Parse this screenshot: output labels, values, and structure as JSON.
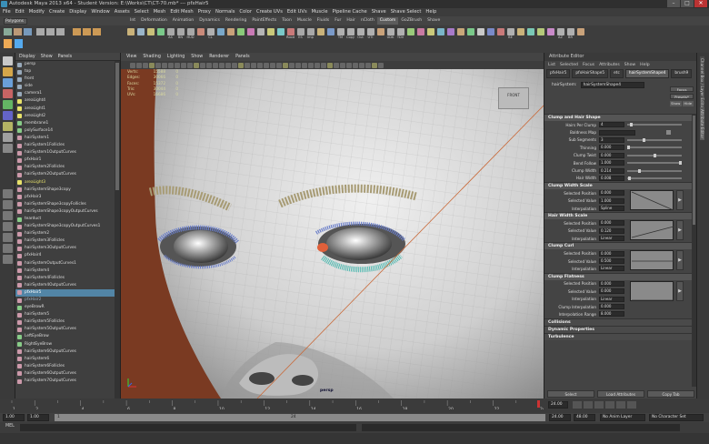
{
  "window": {
    "title": "Autodesk Maya 2013 x64 - Student Version: E:\\Works\\CT\\CT-70.mb* --- pfxHair5",
    "minimize_glyph": "–",
    "maximize_glyph": "□",
    "close_glyph": "✕"
  },
  "menubar": [
    "File",
    "Edit",
    "Modify",
    "Create",
    "Display",
    "Window",
    "Assets",
    "Select",
    "Mesh",
    "Edit Mesh",
    "Proxy",
    "Normals",
    "Color",
    "Create UVs",
    "Edit UVs",
    "Muscle",
    "Pipeline Cache",
    "Shave",
    "Shave Select",
    "Help"
  ],
  "mode_selector": "Polygons",
  "shelf_tabs": [
    {
      "label": "Int",
      "active": false
    },
    {
      "label": "Deformation",
      "active": false
    },
    {
      "label": "Animation",
      "active": false
    },
    {
      "label": "Dynamics",
      "active": false
    },
    {
      "label": "Rendering",
      "active": false
    },
    {
      "label": "PaintEffects",
      "active": false
    },
    {
      "label": "Toon",
      "active": false
    },
    {
      "label": "Muscle",
      "active": false
    },
    {
      "label": "Fluids",
      "active": false
    },
    {
      "label": "Fur",
      "active": false
    },
    {
      "label": "Hair",
      "active": false
    },
    {
      "label": "nCloth",
      "active": false
    },
    {
      "label": "Custom",
      "active": true
    },
    {
      "label": "GoZBrush",
      "active": false
    },
    {
      "label": "Shave",
      "active": false
    }
  ],
  "shelf_icons": [
    {
      "label": "",
      "color": "#c9b27a"
    },
    {
      "label": "",
      "color": "#9ab5c9"
    },
    {
      "label": "",
      "color": "#c9c07a"
    },
    {
      "label": "",
      "color": "#7ac98a"
    },
    {
      "label": "AS",
      "color": "#a8a8a8"
    },
    {
      "label": "BN",
      "color": "#a8a8a8"
    },
    {
      "label": "HUD",
      "color": "#a8a8a8"
    },
    {
      "label": "",
      "color": "#c98a7a"
    },
    {
      "label": "CL",
      "color": "#b0b0b0"
    },
    {
      "label": "",
      "color": "#7aa8c9"
    },
    {
      "label": "",
      "color": "#c9a27a"
    },
    {
      "label": "",
      "color": "#8ac97a"
    },
    {
      "label": "",
      "color": "#c97ab5"
    },
    {
      "label": "",
      "color": "#b5b5b5"
    },
    {
      "label": "",
      "color": "#c9c97a"
    },
    {
      "label": "",
      "color": "#7ac9c9"
    },
    {
      "label": "Rood",
      "color": "#c97a7a"
    },
    {
      "label": "ES",
      "color": "#a8a8a8"
    },
    {
      "label": "Imp",
      "color": "#a8a8a8"
    },
    {
      "label": "",
      "color": "#c9b27a"
    },
    {
      "label": "",
      "color": "#7a9ac9"
    },
    {
      "label": "TM",
      "color": "#b0b0b0"
    },
    {
      "label": "Copy",
      "color": "#b0b0b0"
    },
    {
      "label": "Out",
      "color": "#b0b0b0"
    },
    {
      "label": "UTI",
      "color": "#b0b0b0"
    },
    {
      "label": "",
      "color": "#c9a27a"
    },
    {
      "label": "UDK",
      "color": "#b0b0b0"
    },
    {
      "label": "TDV",
      "color": "#b0b0b0"
    },
    {
      "label": "",
      "color": "#9ac97a"
    },
    {
      "label": "",
      "color": "#c97aa2"
    },
    {
      "label": "",
      "color": "#c9c97a"
    },
    {
      "label": "",
      "color": "#7ab5c9"
    },
    {
      "label": "",
      "color": "#a87ac9"
    },
    {
      "label": "",
      "color": "#c9a87a"
    },
    {
      "label": "",
      "color": "#7ac98a"
    },
    {
      "label": "",
      "color": "#c9c9c9"
    },
    {
      "label": "",
      "color": "#7a8ac9"
    },
    {
      "label": "",
      "color": "#c97a7a"
    },
    {
      "label": "BE",
      "color": "#b0b0b0"
    },
    {
      "label": "",
      "color": "#c9b27a"
    },
    {
      "label": "",
      "color": "#7ac9b5"
    },
    {
      "label": "",
      "color": "#b5c97a"
    },
    {
      "label": "",
      "color": "#c98ac9"
    },
    {
      "label": "AZ",
      "color": "#b0b0b0"
    },
    {
      "label": "BR",
      "color": "#b0b0b0"
    },
    {
      "label": "",
      "color": "#c9a27a"
    }
  ],
  "outliner": {
    "menu": [
      "Display",
      "Show",
      "Panels"
    ],
    "items": [
      {
        "label": "persp",
        "glyph": "#9ab",
        "style": "normal"
      },
      {
        "label": "top",
        "glyph": "#9ab",
        "style": "normal"
      },
      {
        "label": "front",
        "glyph": "#9ab",
        "style": "normal"
      },
      {
        "label": "side",
        "glyph": "#9ab",
        "style": "normal"
      },
      {
        "label": "camera1",
        "glyph": "#9ab",
        "style": "normal"
      },
      {
        "label": "areaLight4",
        "glyph": "#e8e26a",
        "style": "normal"
      },
      {
        "label": "areaLight1",
        "glyph": "#e8e26a",
        "style": "normal"
      },
      {
        "label": "areaLight2",
        "glyph": "#e8e26a",
        "style": "normal"
      },
      {
        "label": "membrane1",
        "glyph": "#8c8",
        "style": "normal"
      },
      {
        "label": "polySurface14",
        "glyph": "#8c8",
        "style": "normal"
      },
      {
        "label": "hairSystem1",
        "glyph": "#c9a",
        "style": "normal"
      },
      {
        "label": "hairSystem1Follicles",
        "glyph": "#c9a",
        "style": "normal"
      },
      {
        "label": "hairSystem1OutputCurves",
        "glyph": "#c9a",
        "style": "normal"
      },
      {
        "label": "pfxHair1",
        "glyph": "#c9a",
        "style": "normal"
      },
      {
        "label": "hairSystem2Follicles",
        "glyph": "#c9a",
        "style": "normal"
      },
      {
        "label": "hairSystem2OutputCurves",
        "glyph": "#c9a",
        "style": "normal"
      },
      {
        "label": "areaLight3",
        "glyph": "#e8e26a",
        "style": "yel"
      },
      {
        "label": "hairSystemShape3copy",
        "glyph": "#c9a",
        "style": "normal"
      },
      {
        "label": "pfxHair3",
        "glyph": "#c9a",
        "style": "normal"
      },
      {
        "label": "hairSystemShape3copyFollicles",
        "glyph": "#c9a",
        "style": "normal"
      },
      {
        "label": "hairSystemShape3copyOutputCurves",
        "glyph": "#c9a",
        "style": "normal"
      },
      {
        "label": "tearduct",
        "glyph": "#8c8",
        "style": "normal"
      },
      {
        "label": "hairSystemShape3copyOutputCurves1",
        "glyph": "#c9a",
        "style": "normal"
      },
      {
        "label": "hairSystem2",
        "glyph": "#c9a",
        "style": "normal"
      },
      {
        "label": "hairSystem3Follicles",
        "glyph": "#c9a",
        "style": "normal"
      },
      {
        "label": "hairSystem3OutputCurves",
        "glyph": "#c9a",
        "style": "normal"
      },
      {
        "label": "pfxHair4",
        "glyph": "#c9a",
        "style": "normal"
      },
      {
        "label": "hairSystemOutputCurves1",
        "glyph": "#c9a",
        "style": "normal"
      },
      {
        "label": "hairSystem4",
        "glyph": "#c9a",
        "style": "normal"
      },
      {
        "label": "hairSystem4Follicles",
        "glyph": "#c9a",
        "style": "normal"
      },
      {
        "label": "hairSystem4OutputCurves",
        "glyph": "#c9a",
        "style": "normal"
      },
      {
        "label": "pfxHair5",
        "glyph": "#c9a",
        "style": "sel"
      },
      {
        "label": "pfxHair2",
        "glyph": "#c9a",
        "style": "dim"
      },
      {
        "label": "eyeBrowR",
        "glyph": "#8c8",
        "style": "normal"
      },
      {
        "label": "hairSystem5",
        "glyph": "#c9a",
        "style": "normal"
      },
      {
        "label": "hairSystem5Follicles",
        "glyph": "#c9a",
        "style": "normal"
      },
      {
        "label": "hairSystem5OutputCurves",
        "glyph": "#c9a",
        "style": "normal"
      },
      {
        "label": "LeftEyeBrow",
        "glyph": "#8c8",
        "style": "normal"
      },
      {
        "label": "RightEyeBrow",
        "glyph": "#8c8",
        "style": "normal"
      },
      {
        "label": "hairSystem6OutputCurves",
        "glyph": "#c9a",
        "style": "normal"
      },
      {
        "label": "hairSystem6",
        "glyph": "#c9a",
        "style": "normal"
      },
      {
        "label": "hairSystem6Follicles",
        "glyph": "#c9a",
        "style": "normal"
      },
      {
        "label": "hairSystem6OutputCurves",
        "glyph": "#c9a",
        "style": "normal"
      },
      {
        "label": "hairSystem7OutputCurves",
        "glyph": "#c9a",
        "style": "normal"
      }
    ]
  },
  "viewport": {
    "menu": [
      "View",
      "Shading",
      "Lighting",
      "Show",
      "Renderer",
      "Panels"
    ],
    "hud": [
      {
        "label": "Verts:",
        "v1": "15588",
        "v2": "0"
      },
      {
        "label": "Edges:",
        "v1": "30066",
        "v2": "0"
      },
      {
        "label": "Faces:",
        "v1": "15372",
        "v2": "0"
      },
      {
        "label": "Tris:",
        "v1": "30044",
        "v2": "0"
      },
      {
        "label": "UVs:",
        "v1": "16686",
        "v2": "0"
      }
    ],
    "viewcube_label": "FRONT",
    "camera_label": "persp",
    "colors": {
      "background": "#7a3a22",
      "skin": "#d9d9d9",
      "lash_blue": "#6a7ec9",
      "lash_teal": "#4fb9b0",
      "brow": "#a79b74"
    }
  },
  "attribute_editor": {
    "title": "Attribute Editor",
    "menu": [
      "List",
      "Selected",
      "Focus",
      "Attributes",
      "Show",
      "Help"
    ],
    "tabs": [
      {
        "label": "pfxHair5",
        "active": false
      },
      {
        "label": "pfxHairShape5",
        "active": false
      },
      {
        "label": "etc",
        "active": false
      },
      {
        "label": "hairSystemShape4",
        "active": true
      },
      {
        "label": "brush9",
        "active": false
      }
    ],
    "node_label": "hairSystem:",
    "node_value": "hairSystemShape4",
    "focus_button": "Focus",
    "presets_button": "Presets*",
    "show_label": "Show",
    "hide_label": "Hide",
    "sections": {
      "clump_hair_shape": {
        "title": "Clump and Hair Shape",
        "rows": [
          {
            "label": "Hairs Per Clump",
            "value": "4",
            "slider": 0.05
          },
          {
            "label": "Baldness Map",
            "value": "",
            "slider": null
          },
          {
            "label": "Sub Segments",
            "value": "3",
            "slider": 0.3
          },
          {
            "label": "Thinning",
            "value": "0.000",
            "slider": 0.0
          },
          {
            "label": "Clump Twist",
            "value": "0.000",
            "slider": 0.5
          },
          {
            "label": "Bend Follow",
            "value": "1.000",
            "slider": 1.0
          },
          {
            "label": "Clump Width",
            "value": "0.214",
            "slider": 0.21
          },
          {
            "label": "Hair Width",
            "value": "0.008",
            "slider": 0.01
          }
        ]
      },
      "clump_width_scale": {
        "title": "Clump Width Scale",
        "rows": [
          {
            "label": "Selected Position",
            "value": "0.000"
          },
          {
            "label": "Selected Value",
            "value": "1.000"
          },
          {
            "label": "Interpolation",
            "value": "Spline"
          }
        ]
      },
      "hair_width_scale": {
        "title": "Hair Width Scale",
        "rows": [
          {
            "label": "Selected Position",
            "value": "0.000"
          },
          {
            "label": "Selected Value",
            "value": "0.120"
          },
          {
            "label": "Interpolation",
            "value": "Linear"
          }
        ]
      },
      "clump_curl": {
        "title": "Clump Curl",
        "rows": [
          {
            "label": "Selected Position",
            "value": "0.000"
          },
          {
            "label": "Selected Value",
            "value": "0.500"
          },
          {
            "label": "Interpolation",
            "value": "Linear"
          }
        ]
      },
      "clump_flatness": {
        "title": "Clump Flatness",
        "rows": [
          {
            "label": "Selected Position",
            "value": "0.000"
          },
          {
            "label": "Selected Value",
            "value": "0.000"
          },
          {
            "label": "Interpolation",
            "value": "Linear"
          }
        ],
        "extra": [
          {
            "label": "Clump Interpolation",
            "value": "0.000"
          },
          {
            "label": "Interpolation Range",
            "value": "8.000"
          }
        ]
      }
    },
    "collapsed_sections": [
      "Collisions",
      "Dynamic Properties",
      "Turbulence"
    ],
    "bottom_buttons": [
      "Select",
      "Load Attributes",
      "Copy Tab"
    ],
    "ramp_arrow": "▶"
  },
  "right_strip": [
    "Channel Box / Layer Editor",
    "Attribute Editor"
  ],
  "timeline": {
    "ticks": [
      "1",
      "2",
      "4",
      "6",
      "8",
      "10",
      "12",
      "14",
      "16",
      "18",
      "20",
      "22",
      "24"
    ],
    "current_frame": "24.00",
    "range_start": "1.00",
    "range_inner_start": "1.00",
    "range_bar_start": "1",
    "range_bar_end": "24",
    "range_end": "24.00",
    "range_end2": "48.00",
    "anim_layer": "No Anim Layer",
    "char_set": "No Character Set"
  },
  "command_line": {
    "label": "MEL"
  }
}
